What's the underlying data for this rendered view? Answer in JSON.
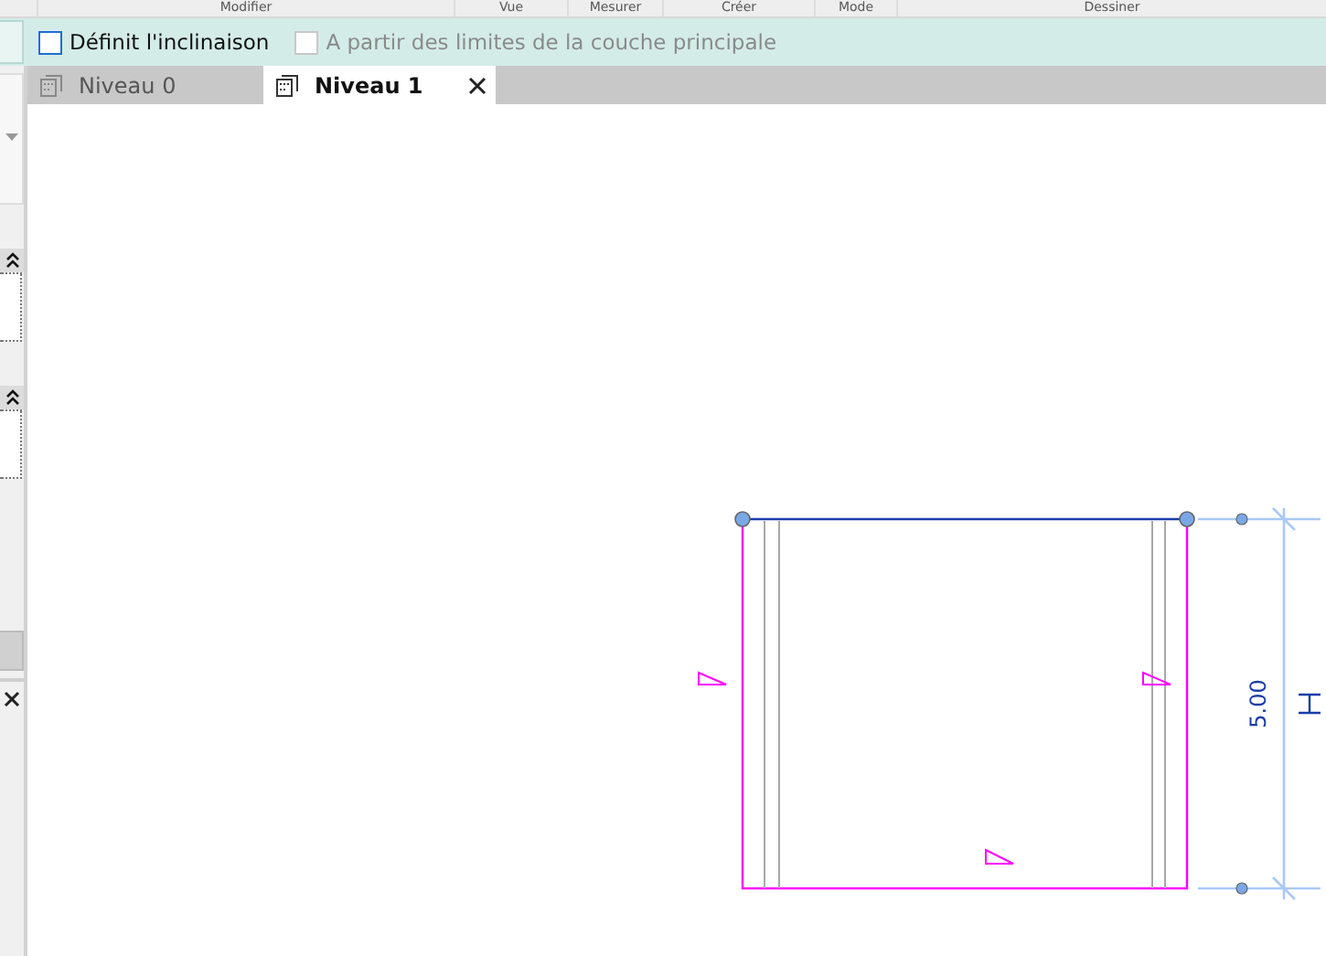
{
  "ribbon_groups": [
    "Modifier",
    "Vue",
    "Mesurer",
    "Créer",
    "Mode",
    "Dessiner"
  ],
  "options": [
    {
      "label": "Définit l'inclinaison",
      "checked": false,
      "disabled": false
    },
    {
      "label": "A partir des limites de la couche principale",
      "checked": false,
      "disabled": true
    }
  ],
  "tabs": [
    {
      "label": "Niveau 0",
      "selected": false
    },
    {
      "label": "Niveau 1",
      "selected": true
    }
  ],
  "dimension": {
    "text": "5.00"
  }
}
